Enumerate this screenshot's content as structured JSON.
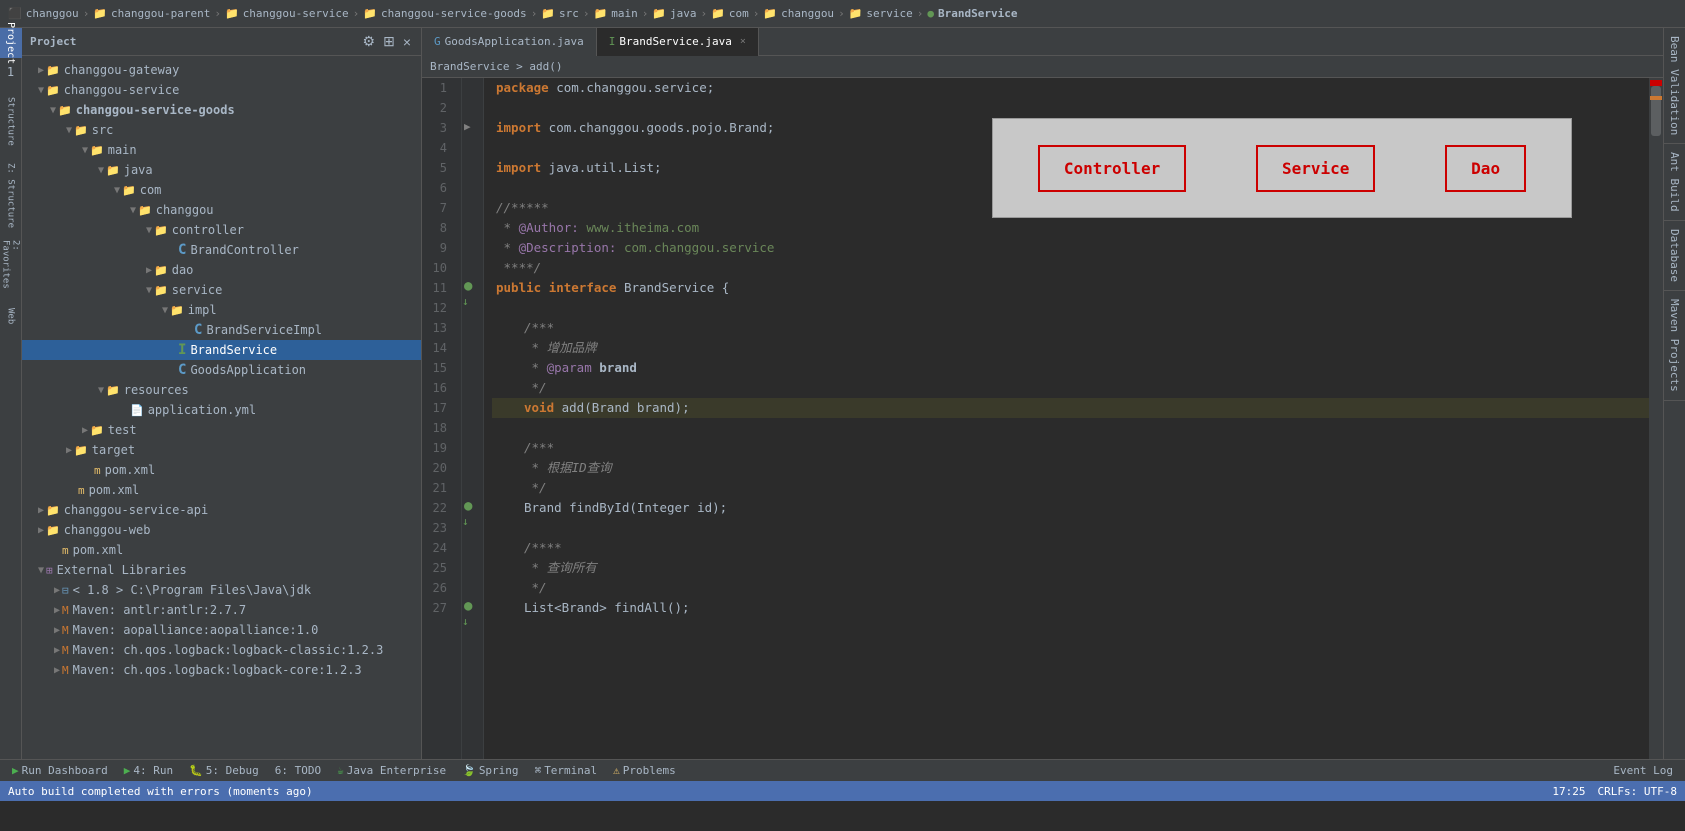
{
  "breadcrumb": {
    "items": [
      {
        "label": "changgou",
        "icon": "project-icon"
      },
      {
        "label": "changgou-parent",
        "icon": "folder-icon"
      },
      {
        "label": "changgou-service",
        "icon": "folder-icon"
      },
      {
        "label": "changgou-service-goods",
        "icon": "folder-icon"
      },
      {
        "label": "src",
        "icon": "folder-icon"
      },
      {
        "label": "main",
        "icon": "folder-icon"
      },
      {
        "label": "java",
        "icon": "folder-icon"
      },
      {
        "label": "com",
        "icon": "folder-icon"
      },
      {
        "label": "changgou",
        "icon": "folder-icon"
      },
      {
        "label": "service",
        "icon": "folder-icon"
      },
      {
        "label": "BrandService",
        "icon": "interface-icon"
      }
    ]
  },
  "sidebar": {
    "title": "Project",
    "tree": [
      {
        "id": "changgou-gateway",
        "label": "changgou-gateway",
        "level": 0,
        "type": "module",
        "expanded": false
      },
      {
        "id": "changgou-service",
        "label": "changgou-service",
        "level": 0,
        "type": "module",
        "expanded": true
      },
      {
        "id": "changgou-service-goods",
        "label": "changgou-service-goods",
        "level": 1,
        "type": "module",
        "expanded": true
      },
      {
        "id": "src",
        "label": "src",
        "level": 2,
        "type": "folder",
        "expanded": true
      },
      {
        "id": "main",
        "label": "main",
        "level": 3,
        "type": "folder",
        "expanded": true
      },
      {
        "id": "java",
        "label": "java",
        "level": 4,
        "type": "folder",
        "expanded": true
      },
      {
        "id": "com",
        "label": "com",
        "level": 5,
        "type": "folder",
        "expanded": true
      },
      {
        "id": "changgou-pkg",
        "label": "changgou",
        "level": 6,
        "type": "folder",
        "expanded": true
      },
      {
        "id": "controller",
        "label": "controller",
        "level": 7,
        "type": "folder",
        "expanded": true
      },
      {
        "id": "BrandController",
        "label": "BrandController",
        "level": 8,
        "type": "class"
      },
      {
        "id": "dao",
        "label": "dao",
        "level": 7,
        "type": "folder",
        "expanded": false
      },
      {
        "id": "service",
        "label": "service",
        "level": 7,
        "type": "folder",
        "expanded": true
      },
      {
        "id": "impl",
        "label": "impl",
        "level": 8,
        "type": "folder",
        "expanded": true
      },
      {
        "id": "BrandServiceImpl",
        "label": "BrandServiceImpl",
        "level": 9,
        "type": "class"
      },
      {
        "id": "BrandService",
        "label": "BrandService",
        "level": 8,
        "type": "interface",
        "selected": true
      },
      {
        "id": "GoodsApplication",
        "label": "GoodsApplication",
        "level": 8,
        "type": "class"
      },
      {
        "id": "resources",
        "label": "resources",
        "level": 4,
        "type": "folder",
        "expanded": true
      },
      {
        "id": "application.yml",
        "label": "application.yml",
        "level": 5,
        "type": "yaml"
      },
      {
        "id": "test",
        "label": "test",
        "level": 3,
        "type": "folder",
        "expanded": false
      },
      {
        "id": "target",
        "label": "target",
        "level": 2,
        "type": "folder",
        "expanded": false
      },
      {
        "id": "pom-goods",
        "label": "pom.xml",
        "level": 2,
        "type": "xml"
      },
      {
        "id": "pom-service",
        "label": "pom.xml",
        "level": 1,
        "type": "xml"
      },
      {
        "id": "changgou-service-api",
        "label": "changgou-service-api",
        "level": 0,
        "type": "module",
        "expanded": false
      },
      {
        "id": "changgou-web",
        "label": "changgou-web",
        "level": 0,
        "type": "module",
        "expanded": false
      },
      {
        "id": "pom-web",
        "label": "pom.xml",
        "level": 1,
        "type": "xml"
      },
      {
        "id": "External Libraries",
        "label": "External Libraries",
        "level": 0,
        "type": "ext",
        "expanded": true
      },
      {
        "id": "jdk",
        "label": "< 1.8 > C:\\Program Files\\Java\\jdk",
        "level": 1,
        "type": "sdk",
        "expanded": false
      },
      {
        "id": "antlr",
        "label": "Maven: antlr:antlr:2.7.7",
        "level": 1,
        "type": "lib",
        "expanded": false
      },
      {
        "id": "aop",
        "label": "Maven: aopalliance:aopalliance:1.0",
        "level": 1,
        "type": "lib",
        "expanded": false
      },
      {
        "id": "logback-classic",
        "label": "Maven: ch.qos.logback:logback-classic:1.2.3",
        "level": 1,
        "type": "lib",
        "expanded": false
      },
      {
        "id": "logback-core",
        "label": "Maven: ch.qos.logback:logback-core:1.2.3",
        "level": 1,
        "type": "lib",
        "expanded": false
      }
    ]
  },
  "editor": {
    "tabs": [
      {
        "id": "GoodsApplication",
        "label": "GoodsApplication.java",
        "type": "class",
        "active": false
      },
      {
        "id": "BrandService",
        "label": "BrandService.java",
        "type": "interface",
        "active": true
      }
    ],
    "nav_breadcrumb": "BrandService > add()",
    "lines": [
      {
        "n": 1,
        "code": "package com.changgou.service;",
        "tokens": [
          {
            "t": "kw",
            "v": "package"
          },
          {
            "t": "type",
            "v": " com.changgou.service;"
          }
        ]
      },
      {
        "n": 2,
        "code": "",
        "tokens": []
      },
      {
        "n": 3,
        "code": "import com.changgou.goods.pojo.Brand;",
        "tokens": [
          {
            "t": "kw",
            "v": "import"
          },
          {
            "t": "type",
            "v": " com.changgou.goods.pojo.Brand;"
          }
        ]
      },
      {
        "n": 4,
        "code": "",
        "tokens": []
      },
      {
        "n": 5,
        "code": "import java.util.List;",
        "tokens": [
          {
            "t": "kw",
            "v": "import"
          },
          {
            "t": "type",
            "v": " java.util.List;"
          }
        ]
      },
      {
        "n": 6,
        "code": "",
        "tokens": []
      },
      {
        "n": 7,
        "code": "//*****",
        "tokens": [
          {
            "t": "comment",
            "v": "//*****"
          }
        ]
      },
      {
        "n": 8,
        "code": " * @Author: www.itheima.com",
        "tokens": [
          {
            "t": "comment",
            "v": " * "
          },
          {
            "t": "ann-key",
            "v": "@Author:"
          },
          {
            "t": "ann-val",
            "v": " www.itheima.com"
          }
        ]
      },
      {
        "n": 9,
        "code": " * @Description: com.changgou.service",
        "tokens": [
          {
            "t": "comment",
            "v": " * "
          },
          {
            "t": "ann-key",
            "v": "@Description:"
          },
          {
            "t": "ann-val",
            "v": " com.changgou.service"
          }
        ]
      },
      {
        "n": 10,
        "code": " ****/",
        "tokens": [
          {
            "t": "comment",
            "v": " ****/"
          }
        ]
      },
      {
        "n": 11,
        "code": "public interface BrandService {",
        "tokens": [
          {
            "t": "kw",
            "v": "public"
          },
          {
            "t": "type",
            "v": " "
          },
          {
            "t": "kw",
            "v": "interface"
          },
          {
            "t": "type",
            "v": " BrandService {"
          }
        ]
      },
      {
        "n": 12,
        "code": "",
        "tokens": []
      },
      {
        "n": 13,
        "code": "    /***",
        "tokens": [
          {
            "t": "comment",
            "v": "    /***"
          }
        ]
      },
      {
        "n": 14,
        "code": "     * 增加品牌",
        "tokens": [
          {
            "t": "comment",
            "v": "     * 增加品牌"
          }
        ]
      },
      {
        "n": 15,
        "code": "     * @param brand",
        "tokens": [
          {
            "t": "comment",
            "v": "     * "
          },
          {
            "t": "ann-key",
            "v": "@param"
          },
          {
            "t": "type",
            "v": " brand"
          }
        ]
      },
      {
        "n": 16,
        "code": "     */",
        "tokens": [
          {
            "t": "comment",
            "v": "     */"
          }
        ]
      },
      {
        "n": 17,
        "code": "    void add(Brand brand);",
        "tokens": [
          {
            "t": "type",
            "v": "    "
          },
          {
            "t": "kw",
            "v": "void"
          },
          {
            "t": "type",
            "v": " add(Brand "
          },
          {
            "t": "param",
            "v": "brand"
          },
          {
            "t": "type",
            "v": ");"
          }
        ],
        "highlighted": true
      },
      {
        "n": 18,
        "code": "",
        "tokens": []
      },
      {
        "n": 19,
        "code": "    /***",
        "tokens": [
          {
            "t": "comment",
            "v": "    /***"
          }
        ]
      },
      {
        "n": 20,
        "code": "     * 根据ID查询",
        "tokens": [
          {
            "t": "comment",
            "v": "     * 根据ID查询"
          }
        ]
      },
      {
        "n": 21,
        "code": "     */",
        "tokens": [
          {
            "t": "comment",
            "v": "     */"
          }
        ]
      },
      {
        "n": 22,
        "code": "    Brand findById(Integer id);",
        "tokens": [
          {
            "t": "type",
            "v": "    Brand findById(Integer id);"
          }
        ]
      },
      {
        "n": 23,
        "code": "",
        "tokens": []
      },
      {
        "n": 24,
        "code": "    /****",
        "tokens": [
          {
            "t": "comment",
            "v": "    /****"
          }
        ]
      },
      {
        "n": 25,
        "code": "     * 查询所有",
        "tokens": [
          {
            "t": "comment",
            "v": "     * 查询所有"
          }
        ]
      },
      {
        "n": 26,
        "code": "     */",
        "tokens": [
          {
            "t": "comment",
            "v": "     */"
          }
        ]
      },
      {
        "n": 27,
        "code": "    List<Brand> findAll();",
        "tokens": [
          {
            "t": "type",
            "v": "    List<Brand> findAll();"
          }
        ]
      }
    ]
  },
  "popup": {
    "buttons": [
      {
        "id": "controller-btn",
        "label": "Controller"
      },
      {
        "id": "service-btn",
        "label": "Service"
      },
      {
        "id": "dao-btn",
        "label": "Dao"
      }
    ]
  },
  "right_panels": [
    "Bean Validation",
    "Ant Build",
    "Database",
    "Maven Projects"
  ],
  "left_panels": [
    "Project",
    "Structure",
    "Z: Structure",
    "Favorites",
    "Web"
  ],
  "bottom_bar": {
    "items": [
      {
        "id": "run-dashboard",
        "icon": "▶",
        "label": "Run Dashboard"
      },
      {
        "id": "run",
        "icon": "▶",
        "label": "4: Run"
      },
      {
        "id": "debug",
        "icon": "🐛",
        "label": "5: Debug"
      },
      {
        "id": "todo",
        "icon": "",
        "label": "6: TODO"
      },
      {
        "id": "java-enterprise",
        "icon": "",
        "label": "Java Enterprise"
      },
      {
        "id": "spring",
        "icon": "",
        "label": "Spring"
      },
      {
        "id": "terminal",
        "icon": "",
        "label": "Terminal"
      },
      {
        "id": "problems",
        "icon": "⚠",
        "label": "Problems"
      }
    ],
    "right_items": [
      "Event Log"
    ]
  },
  "status_bar": {
    "message": "Auto build completed with errors (moments ago)",
    "right": {
      "time": "17:25",
      "encoding": "CRLFs: UTF-8",
      "position": ""
    }
  }
}
